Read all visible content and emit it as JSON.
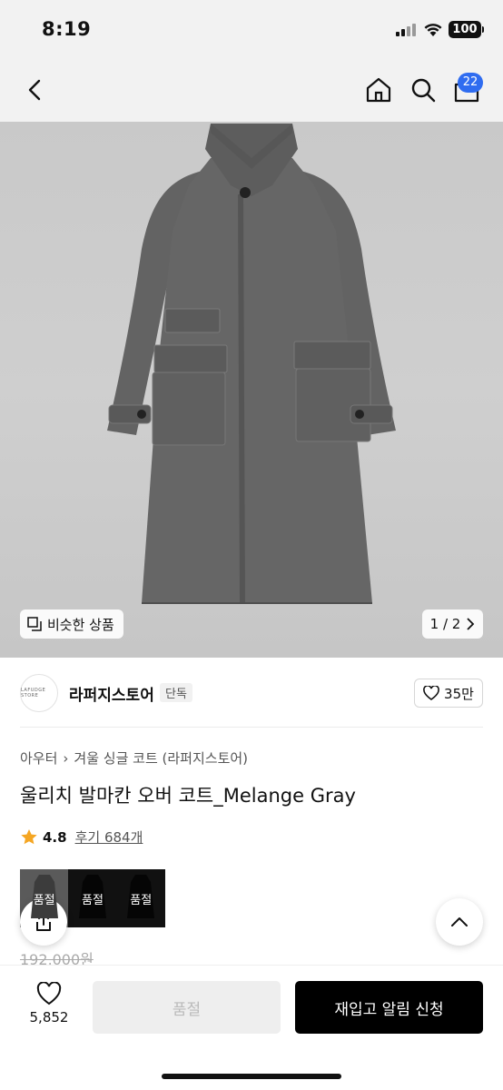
{
  "status_bar": {
    "time": "8:19",
    "battery": "100"
  },
  "nav": {
    "cart_count": "22",
    "icons": [
      "back-icon",
      "home-icon",
      "search-icon",
      "cart-icon"
    ]
  },
  "gallery": {
    "similar_label": "비슷한 상품",
    "pager": "1 / 2",
    "image": "gray-overcoat"
  },
  "store": {
    "logo_text": "LAFUDGE STORE",
    "name": "라퍼지스토어",
    "tag": "단독",
    "likes": "35만"
  },
  "product": {
    "breadcrumb": [
      "아우터",
      "겨울 싱글 코트 (라퍼지스토어)"
    ],
    "title": "울리치 발마칸 오버 코트_Melange Gray",
    "rating": "4.8",
    "review_label": "후기 684개",
    "options": [
      {
        "label": "품절",
        "selected": true
      },
      {
        "label": "품절",
        "selected": false
      },
      {
        "label": "품절",
        "selected": false
      }
    ],
    "original_price": "192,000원"
  },
  "bottom_bar": {
    "wish_count": "5,852",
    "soldout_label": "품절",
    "restock_label": "재입고 알림 신청"
  },
  "colors": {
    "accent": "#2f6cf0",
    "star": "#f5a623",
    "primary_button": "#000000"
  }
}
